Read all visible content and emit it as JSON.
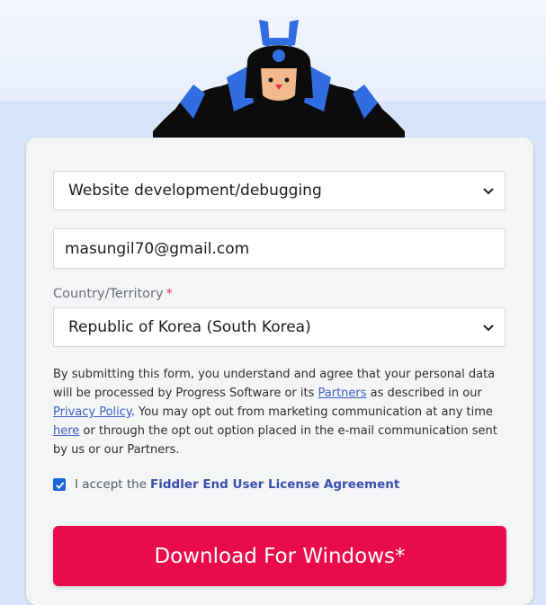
{
  "form": {
    "use_case_selected": "Website development/debugging",
    "email_value": "masungil70@gmail.com",
    "country_label": "Country/Territory",
    "required_marker": "*",
    "country_selected": "Republic of Korea (South Korea)",
    "consent": {
      "part1": "By submitting this form, you understand and agree that your personal data will be processed by Progress Software or its ",
      "partners_link": "Partners",
      "part2": " as described in our ",
      "privacy_link": "Privacy Policy",
      "part3": ". You may opt out from marketing communication at any time ",
      "here_link": "here",
      "part4": " or through the opt out option placed in the e-mail communication sent by us or our Partners."
    },
    "accept_text": "I accept the",
    "eula_link": "Fiddler End User License Agreement",
    "download_label": "Download For Windows*"
  },
  "colors": {
    "download_button": "#ea0b4b",
    "link": "#3a5fc6",
    "checkbox": "#1a66d9",
    "background": "#d6e5fa"
  },
  "icons": [
    "chevron-down-icon",
    "check-icon",
    "mascot-illustration"
  ]
}
